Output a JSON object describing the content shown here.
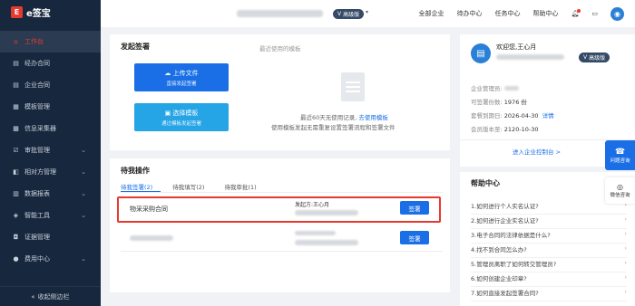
{
  "brand": {
    "name": "e签宝",
    "mark": "E"
  },
  "sidebar": {
    "items": [
      {
        "label": "工作台",
        "icon": "home-icon",
        "active": true,
        "chev": false
      },
      {
        "label": "经办合同",
        "icon": "document-icon",
        "chev": false
      },
      {
        "label": "企业合同",
        "icon": "document-icon",
        "chev": false
      },
      {
        "label": "模板管理",
        "icon": "template-icon",
        "chev": false
      },
      {
        "label": "信息采集器",
        "icon": "grid-icon",
        "chev": false
      },
      {
        "label": "审批管理",
        "icon": "approve-icon",
        "chev": true
      },
      {
        "label": "相对方管理",
        "icon": "contacts-icon",
        "chev": true
      },
      {
        "label": "数据报表",
        "icon": "report-icon",
        "chev": true
      },
      {
        "label": "智能工具",
        "icon": "tools-icon",
        "chev": true
      },
      {
        "label": "证据管理",
        "icon": "evidence-icon",
        "chev": false
      },
      {
        "label": "费用中心",
        "icon": "fee-icon",
        "chev": true
      }
    ],
    "collapse": "收起侧边栏",
    "collapse_icon": "«"
  },
  "topbar": {
    "badge": "高级版",
    "nav": [
      "全部企业",
      "待办中心",
      "任务中心",
      "帮助中心"
    ]
  },
  "launch": {
    "title": "发起签署",
    "recent_title": "最近使用的模板",
    "upload_label": "上传文件",
    "upload_sub": "直接发起签署",
    "template_label": "选择模板",
    "template_sub": "通过模板发起签署",
    "empty_text": "最近60天无使用记录,",
    "empty_link": "去使用模板",
    "empty_tip": "使用模板发起无需重复设置签署流程和签署文件"
  },
  "todo": {
    "title": "待我操作",
    "tabs": [
      "待我签署(2)",
      "待我填写(2)",
      "待我审批(1)"
    ],
    "rows": [
      {
        "name": "物采采购合同",
        "sender": "发起方:王心月",
        "action": "签署"
      },
      {
        "name": "",
        "sender": "",
        "action": "签署"
      }
    ]
  },
  "profile": {
    "welcome": "欢迎您,王心月",
    "badge": "高级版",
    "info": [
      {
        "label": "企业管理员:",
        "value": ""
      },
      {
        "label": "可签署份数:",
        "value": "1976 份"
      },
      {
        "label": "套餐到期日:",
        "value": "2026-04-30",
        "link": "详情"
      },
      {
        "label": "会员版本至:",
        "value": "2120-10-30"
      }
    ],
    "console": "进入企业控制台 >"
  },
  "help": {
    "title": "帮助中心",
    "items": [
      "1.如何进行个人实名认证?",
      "2.如何进行企业实名认证?",
      "3.电子合同的法律依据是什么?",
      "4.找不到合同怎么办?",
      "5.管理员离职了如何转交管理员?",
      "6.如何创建企业印章?",
      "7.如何直接发起签署合同?"
    ]
  },
  "float": {
    "consult": "问题咨询",
    "wechat": "微信咨询"
  },
  "colors": {
    "accent": "#1a6fe6",
    "brand": "#e8392f",
    "sidebar": "#17273d"
  }
}
